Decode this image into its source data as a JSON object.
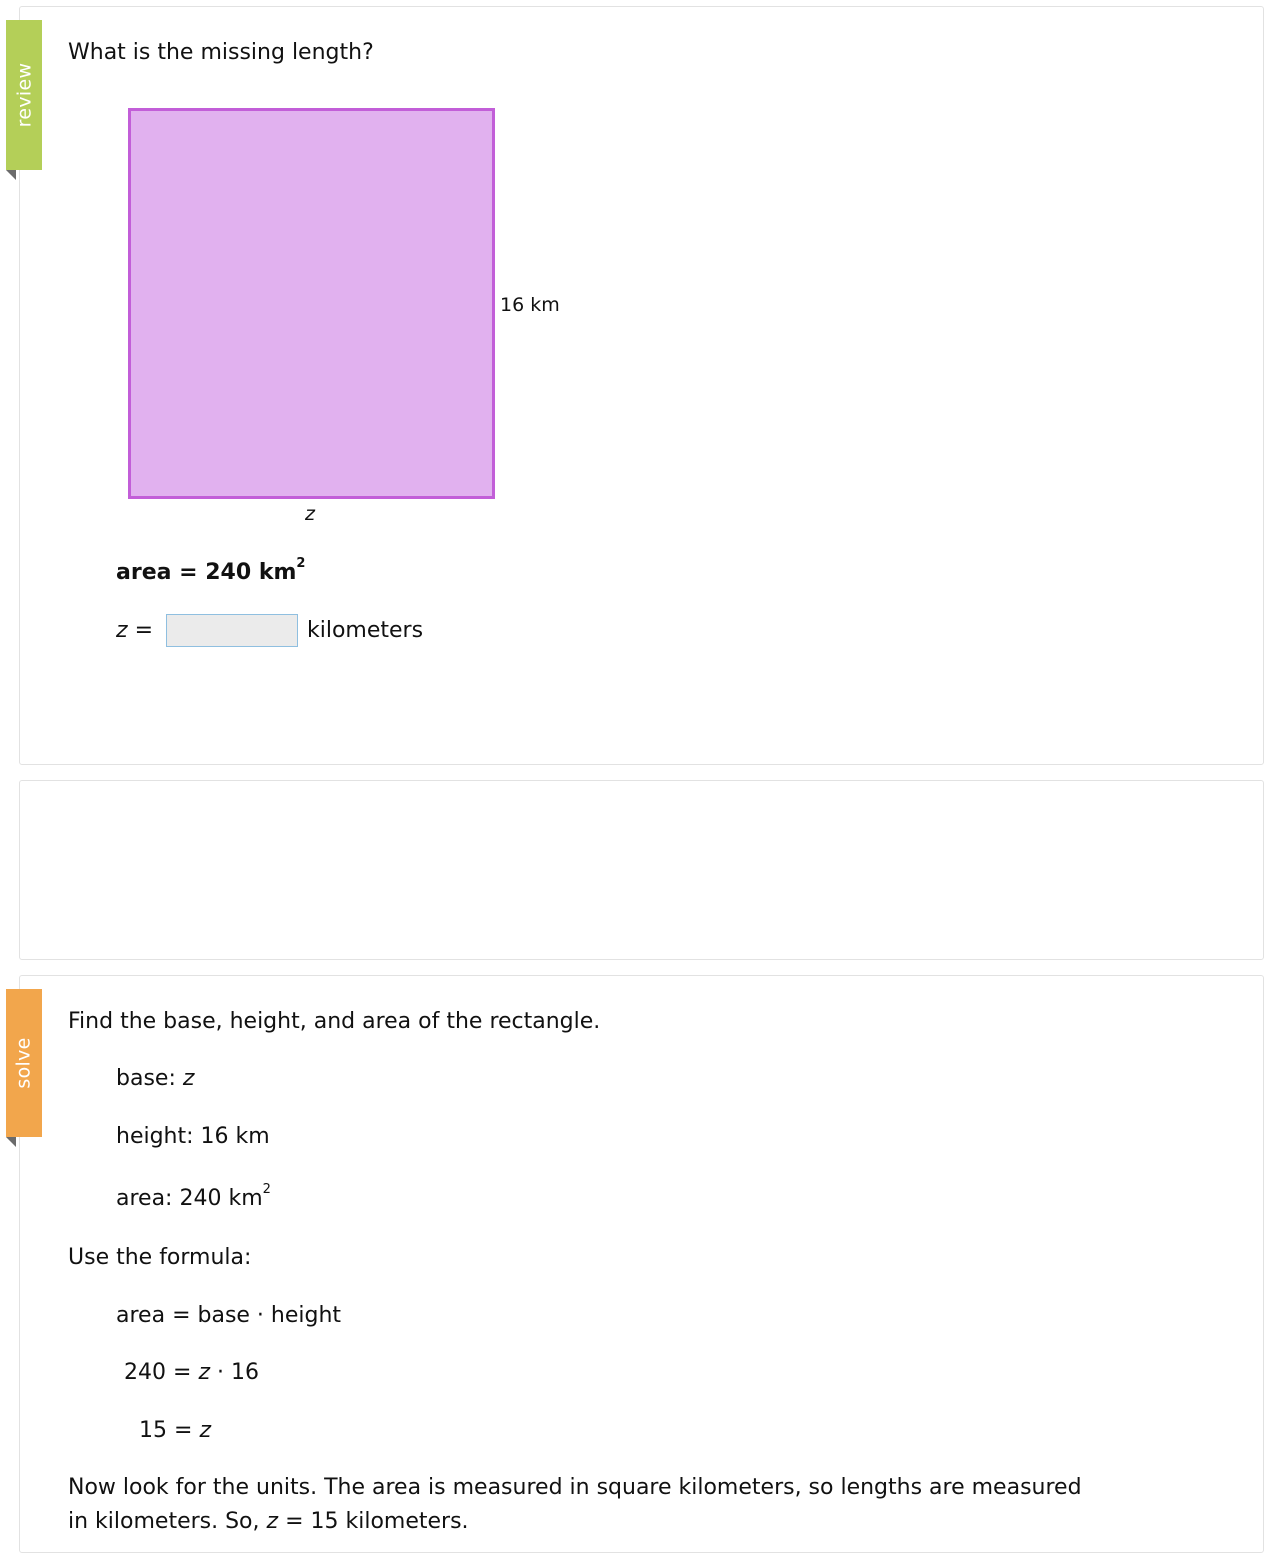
{
  "review": {
    "flag_label": "review",
    "question": "What is the missing length?",
    "figure": {
      "side_label": "16 km",
      "base_label": "z",
      "fill_color": "#e1b1ef",
      "stroke_color": "#c25ed8"
    },
    "area_label": "area",
    "area_equals": "=",
    "area_value": "240 km",
    "area_exponent": "2",
    "answer_var": "z",
    "answer_equals": "=",
    "answer_value": "",
    "answer_unit": "kilometers"
  },
  "solve": {
    "flag_label": "solve",
    "instruction": "Find the base, height, and area of the rectangle.",
    "base_label": "base:",
    "base_value": "z",
    "height_label": "height:",
    "height_value": "16 km",
    "area_label": "area:",
    "area_value": "240 km",
    "area_exponent": "2",
    "formula_intro": "Use the formula:",
    "formula_lhs": "area",
    "formula_eq": "=",
    "formula_rhs": "base · height",
    "step1_lhs": "240",
    "step1_eq": "=",
    "step1_var": "z",
    "step1_rest": " · 16",
    "step2_lhs": "15",
    "step2_eq": "=",
    "step2_var": "z",
    "conclusion_line1": "Now look for the units. The area is measured in square kilometers, so lengths are measured",
    "conclusion_line2_pre": "in kilometers. So, ",
    "conclusion_var": "z",
    "conclusion_line2_post": " = 15 kilometers."
  },
  "colors": {
    "review_flag": "#b4cf58",
    "solve_flag": "#f2a64c"
  }
}
